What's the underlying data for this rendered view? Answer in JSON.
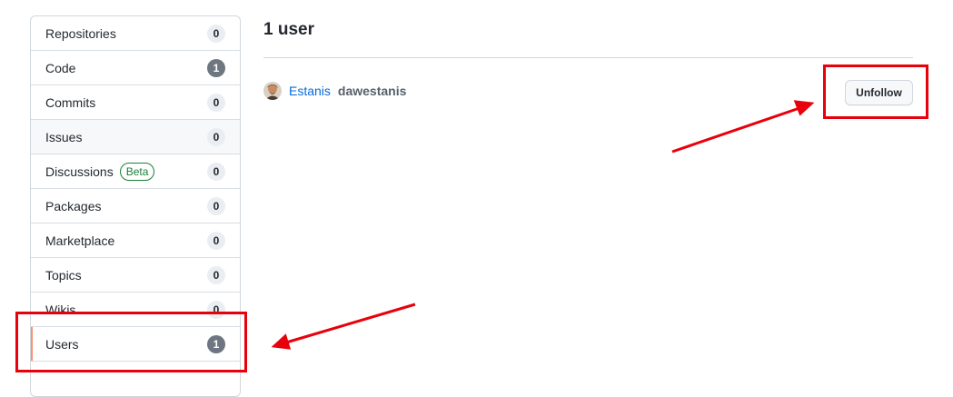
{
  "sidebar": {
    "items": [
      {
        "label": "Repositories",
        "count": "0",
        "primary": false,
        "state": ""
      },
      {
        "label": "Code",
        "count": "1",
        "primary": true,
        "state": ""
      },
      {
        "label": "Commits",
        "count": "0",
        "primary": false,
        "state": ""
      },
      {
        "label": "Issues",
        "count": "0",
        "primary": false,
        "state": "hover"
      },
      {
        "label": "Discussions",
        "badge": "Beta",
        "count": "0",
        "primary": false,
        "state": ""
      },
      {
        "label": "Packages",
        "count": "0",
        "primary": false,
        "state": ""
      },
      {
        "label": "Marketplace",
        "count": "0",
        "primary": false,
        "state": ""
      },
      {
        "label": "Topics",
        "count": "0",
        "primary": false,
        "state": ""
      },
      {
        "label": "Wikis",
        "count": "0",
        "primary": false,
        "state": ""
      },
      {
        "label": "Users",
        "count": "1",
        "primary": true,
        "state": "selected"
      }
    ]
  },
  "main": {
    "title": "1 user",
    "users": [
      {
        "name": "Estanis",
        "login": "dawestanis",
        "action_label": "Unfollow"
      }
    ]
  },
  "annotations": {
    "color": "#e8000b"
  },
  "colors": {
    "link": "#0969da",
    "selected_accent": "#fd8c73",
    "beta_green": "#1a7f37"
  }
}
